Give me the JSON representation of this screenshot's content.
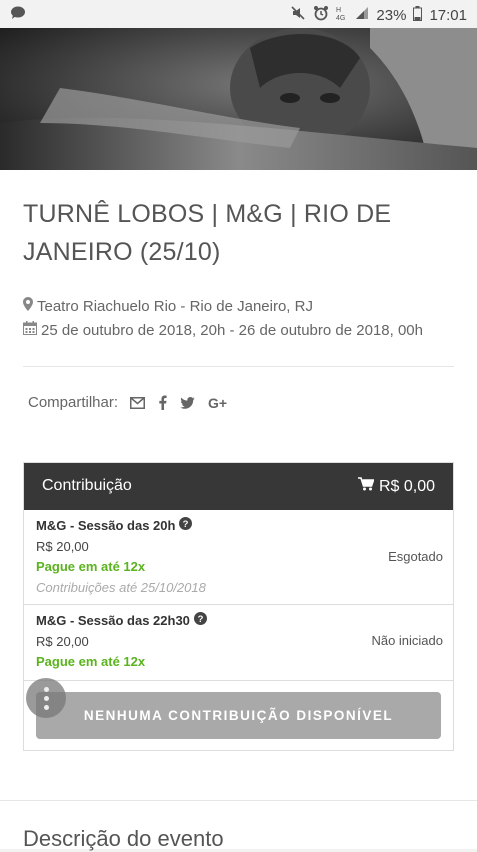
{
  "status_bar": {
    "battery": "23%",
    "time": "17:01",
    "icons": [
      "chat-icon",
      "mute-icon",
      "alarm-icon",
      "hd-signal-icon",
      "signal-icon",
      "battery-icon"
    ]
  },
  "event": {
    "title": "TURNÊ LOBOS | M&G | RIO DE JANEIRO (25/10)",
    "location": "Teatro Riachuelo Rio - Rio de Janeiro, RJ",
    "dates": "25 de outubro de 2018, 20h - 26 de outubro de 2018, 00h"
  },
  "share": {
    "label": "Compartilhar:",
    "icons": [
      "email-icon",
      "facebook-icon",
      "twitter-icon",
      "google-plus-icon"
    ]
  },
  "contribution": {
    "header_label": "Contribuição",
    "total": "R$ 0,00",
    "items": [
      {
        "name": "M&G - Sessão das 20h",
        "price": "R$ 20,00",
        "installments": "Pague em até 12x",
        "until": "Contribuições até 25/10/2018",
        "status": "Esgotado"
      },
      {
        "name": "M&G - Sessão das 22h30",
        "price": "R$ 20,00",
        "installments": "Pague em até 12x",
        "status": "Não iniciado"
      }
    ],
    "button_label": "NENHUMA CONTRIBUIÇÃO DISPONÍVEL"
  },
  "description": {
    "title": "Descrição do evento"
  },
  "colors": {
    "panel_header": "#373737",
    "installments_green": "#5bb31f",
    "disabled_button": "#a9a9a9"
  }
}
